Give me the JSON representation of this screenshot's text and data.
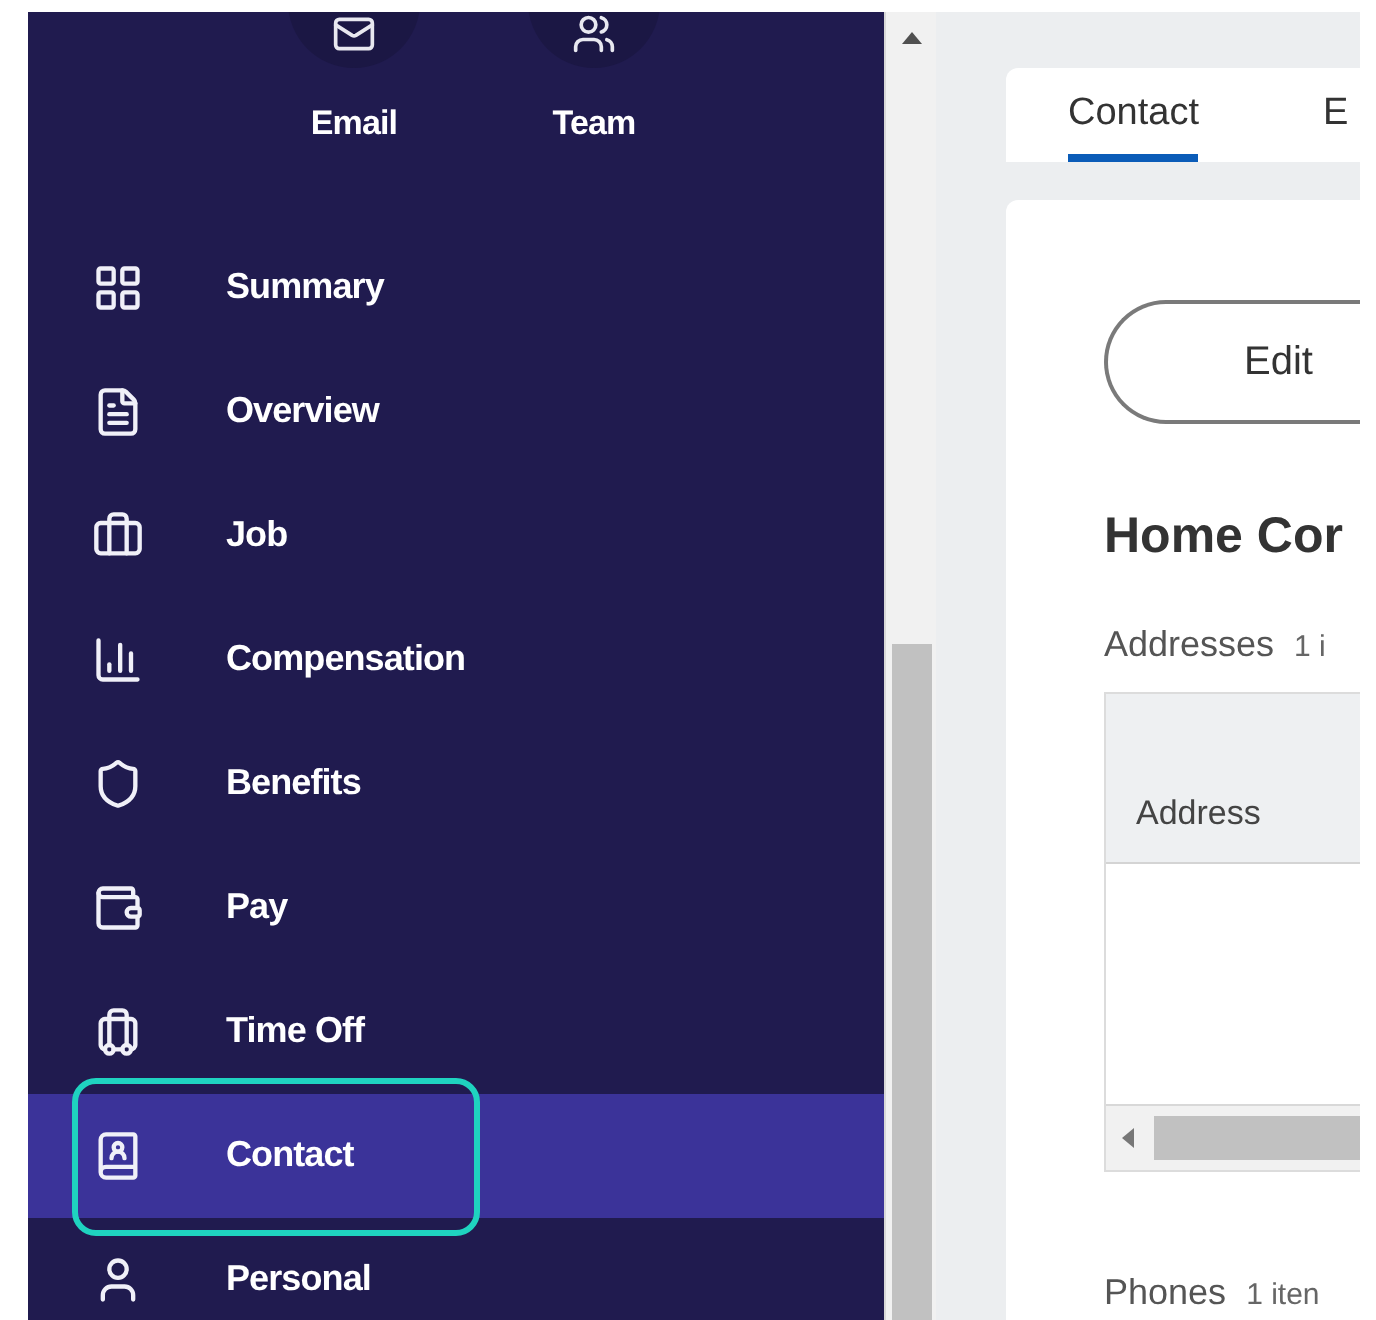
{
  "quick_actions": [
    {
      "label": "Email"
    },
    {
      "label": "Team"
    }
  ],
  "sidebar": {
    "items": [
      {
        "label": "Summary",
        "selected": false,
        "highlighted": false
      },
      {
        "label": "Overview",
        "selected": false,
        "highlighted": false
      },
      {
        "label": "Job",
        "selected": false,
        "highlighted": false
      },
      {
        "label": "Compensation",
        "selected": false,
        "highlighted": false
      },
      {
        "label": "Benefits",
        "selected": false,
        "highlighted": false
      },
      {
        "label": "Pay",
        "selected": false,
        "highlighted": false
      },
      {
        "label": "Time Off",
        "selected": false,
        "highlighted": false
      },
      {
        "label": "Contact",
        "selected": true,
        "highlighted": true
      },
      {
        "label": "Personal",
        "selected": false,
        "highlighted": false
      }
    ]
  },
  "tabs": [
    {
      "label": "Contact",
      "selected": true
    },
    {
      "label": "E",
      "selected": false
    }
  ],
  "edit_button": "Edit",
  "section_title": "Home Cor",
  "addresses": {
    "label": "Addresses",
    "count": "1 i",
    "columns": [
      "Address"
    ]
  },
  "phones": {
    "label": "Phones",
    "count": "1 iten"
  }
}
